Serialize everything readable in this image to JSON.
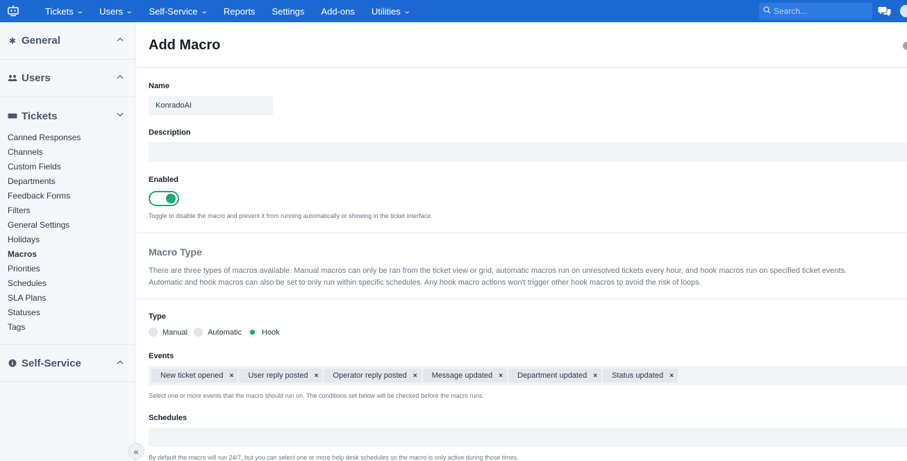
{
  "nav": {
    "items": [
      {
        "label": "Tickets",
        "dropdown": true
      },
      {
        "label": "Users",
        "dropdown": true
      },
      {
        "label": "Self-Service",
        "dropdown": true
      },
      {
        "label": "Reports",
        "dropdown": false
      },
      {
        "label": "Settings",
        "dropdown": false
      },
      {
        "label": "Add-ons",
        "dropdown": false
      },
      {
        "label": "Utilities",
        "dropdown": true
      }
    ],
    "search_placeholder": "Search...",
    "icons": [
      "robot-logo-icon",
      "search-icon",
      "chat-icon",
      "avatar"
    ],
    "colors": {
      "bar": "#1c6ad1",
      "accent": "#1fa67a"
    }
  },
  "sidebar": {
    "sections": [
      {
        "label": "General",
        "icon": "gear-icon",
        "expanded": false
      },
      {
        "label": "Users",
        "icon": "users-icon",
        "expanded": false
      },
      {
        "label": "Tickets",
        "icon": "ticket-icon",
        "expanded": true
      },
      {
        "label": "Self-Service",
        "icon": "info-icon",
        "expanded": false
      }
    ],
    "ticket_items": [
      "Canned Responses",
      "Channels",
      "Custom Fields",
      "Departments",
      "Feedback Forms",
      "Filters",
      "General Settings",
      "Holidays",
      "Macros",
      "Priorities",
      "Schedules",
      "SLA Plans",
      "Statuses",
      "Tags"
    ],
    "active_item": "Macros",
    "collapse_glyph": "«"
  },
  "form": {
    "title": "Add Macro",
    "name_label": "Name",
    "name_value": "KonradoAI",
    "description_label": "Description",
    "description_value": "",
    "enabled_label": "Enabled",
    "enabled": true,
    "enabled_hint": "Toggle to disable the macro and prevent it from running automatically or showing in the ticket interface.",
    "macro_type_title": "Macro Type",
    "macro_type_desc_1": "There are three types of macros available. Manual macros can only be ran from the ticket view or grid, automatic macros run on unresolved tickets every hour, and hook macros run on specified ticket events.",
    "macro_type_desc_2": "Automatic and hook macros can also be set to only run within specific schedules. Any hook macro actions won't trigger other hook macros to avoid the risk of loops.",
    "type_label": "Type",
    "type_options": [
      "Manual",
      "Automatic",
      "Hook"
    ],
    "type_selected": "Hook",
    "events_label": "Events",
    "events": [
      "New ticket opened",
      "User reply posted",
      "Operator reply posted",
      "Message updated",
      "Department updated",
      "Status updated"
    ],
    "events_hint": "Select one or more events that the macro should run on. The conditions set below will be checked before the macro runs.",
    "schedules_label": "Schedules",
    "schedules_value": "",
    "schedules_hint": "By default the macro will run 24/7, but you can select one or more help desk schedules so the macro is only active during those times."
  }
}
